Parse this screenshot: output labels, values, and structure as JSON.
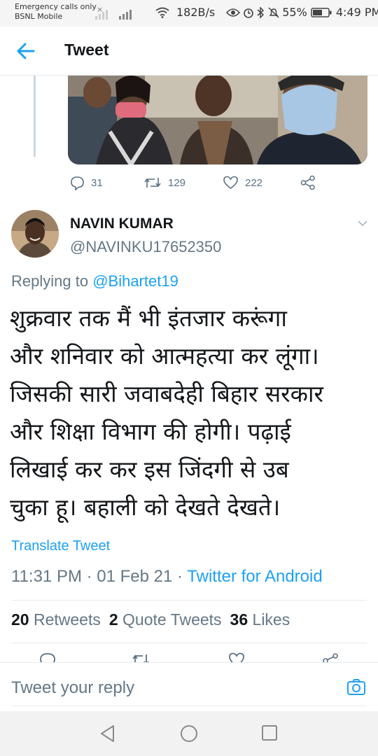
{
  "status_bar": {
    "carrier_line1": "Emergency calls only",
    "carrier_line2": "BSNL Mobile",
    "speed": "182B/s",
    "battery": "55%",
    "time": "4:49 PM"
  },
  "header": {
    "title": "Tweet"
  },
  "previous_tweet": {
    "reply_count": "31",
    "retweet_count": "129",
    "like_count": "222"
  },
  "tweet": {
    "display_name": "NAVIN KUMAR",
    "handle": "@NAVINKU17652350",
    "replying_prefix": "Replying to ",
    "replying_to": "@Bihartet19",
    "text_lines": [
      "शुक्रवार तक मैं भी इंतजार करूंगा",
      "और शनिवार को आत्महत्या कर लूंगा।",
      "जिसकी सारी जवाबदेही बिहार सरकार",
      "और शिक्षा विभाग की होगी। पढ़ाई",
      "लिखाई कर कर इस जिंदगी से उब",
      "चुका हू। बहाली को देखते देखते।"
    ],
    "translate_label": "Translate Tweet",
    "time": "11:31 PM",
    "date": "01 Feb 21",
    "separator": " · ",
    "client": "Twitter for Android",
    "retweets_count": "20",
    "retweets_label": "Retweets",
    "quotes_count": "2",
    "quotes_label": "Quote Tweets",
    "likes_count": "36",
    "likes_label": "Likes"
  },
  "reply_bar": {
    "placeholder": "Tweet your reply"
  },
  "icons": {
    "back": "arrow-left-icon",
    "reply": "speech-bubble-icon",
    "retweet": "retweet-icon",
    "like": "heart-icon",
    "share": "share-icon",
    "camera": "camera-icon",
    "caret": "chevron-down-icon"
  },
  "colors": {
    "accent": "#1da1f2",
    "secondary_text": "#657786",
    "primary_text": "#14171a",
    "divider": "#e6ecf0"
  }
}
